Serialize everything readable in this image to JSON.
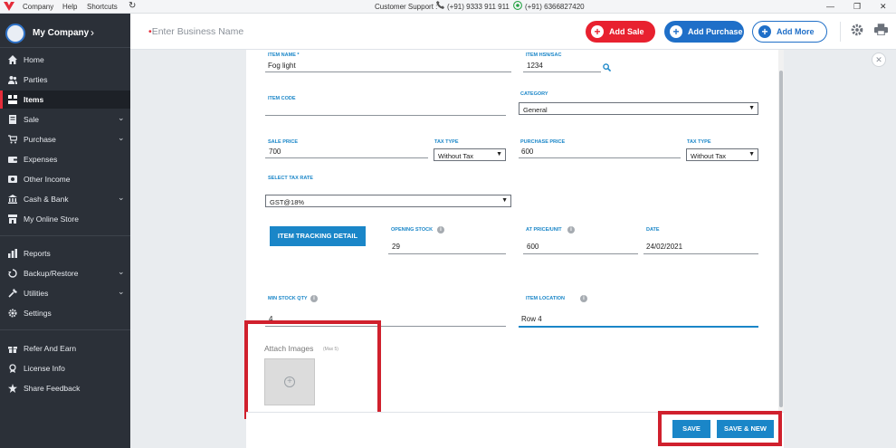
{
  "titlebar": {
    "menu": [
      "Company",
      "Help",
      "Shortcuts"
    ],
    "support_label": "Customer Support :",
    "phone": "(+91) 9333 911 911",
    "whatsapp": "(+91) 6366827420"
  },
  "sidebar": {
    "company_name": "My Company",
    "items": [
      {
        "label": "Home",
        "icon": "home-icon"
      },
      {
        "label": "Parties",
        "icon": "people-icon"
      },
      {
        "label": "Items",
        "icon": "items-icon"
      },
      {
        "label": "Sale",
        "icon": "sale-icon"
      },
      {
        "label": "Purchase",
        "icon": "cart-icon"
      },
      {
        "label": "Expenses",
        "icon": "expenses-icon"
      },
      {
        "label": "Other Income",
        "icon": "income-icon"
      },
      {
        "label": "Cash & Bank",
        "icon": "bank-icon"
      },
      {
        "label": "My Online Store",
        "icon": "store-icon"
      },
      {
        "label": "Reports",
        "icon": "reports-icon"
      },
      {
        "label": "Backup/Restore",
        "icon": "backup-icon"
      },
      {
        "label": "Utilities",
        "icon": "wrench-icon"
      },
      {
        "label": "Settings",
        "icon": "gear-icon"
      },
      {
        "label": "Refer And Earn",
        "icon": "gift-icon"
      },
      {
        "label": "License Info",
        "icon": "license-icon"
      },
      {
        "label": "Share Feedback",
        "icon": "star-icon"
      }
    ]
  },
  "header": {
    "business_placeholder": "Enter Business Name",
    "add_sale": "Add Sale",
    "add_purchase": "Add Purchase",
    "add_more": "Add More",
    "colors": {
      "sale": "#e8212f",
      "purchase": "#1f6fc8",
      "accent": "#1a86c8"
    }
  },
  "form": {
    "item_name_label": "ITEM NAME *",
    "item_name": "Fog light",
    "hsn_label": "ITEM HSN/SAC",
    "hsn": "1234",
    "item_code_label": "ITEM CODE",
    "category_label": "CATEGORY",
    "category": "General",
    "sale_price_label": "SALE PRICE",
    "sale_price": "700",
    "sale_tax_type_label": "TAX TYPE",
    "sale_tax_type": "Without Tax",
    "purchase_price_label": "PURCHASE PRICE",
    "purchase_price": "600",
    "purchase_tax_type_label": "TAX TYPE",
    "purchase_tax_type": "Without Tax",
    "tax_rate_label": "SELECT TAX RATE",
    "tax_rate": "GST@18%",
    "tracking_button": "ITEM TRACKING DETAIL",
    "opening_stock_label": "OPENING STOCK",
    "opening_stock": "29",
    "price_unit_label": "AT PRICE/UNIT",
    "price_unit": "600",
    "date_label": "DATE",
    "date": "24/02/2021",
    "min_stock_label": "MIN STOCK QTY",
    "min_stock": "4",
    "location_label": "ITEM LOCATION",
    "location": "Row 4",
    "attach_label": "Attach Images",
    "attach_note": "(Max 5)"
  },
  "footer": {
    "save": "SAVE",
    "save_new": "SAVE & NEW"
  }
}
